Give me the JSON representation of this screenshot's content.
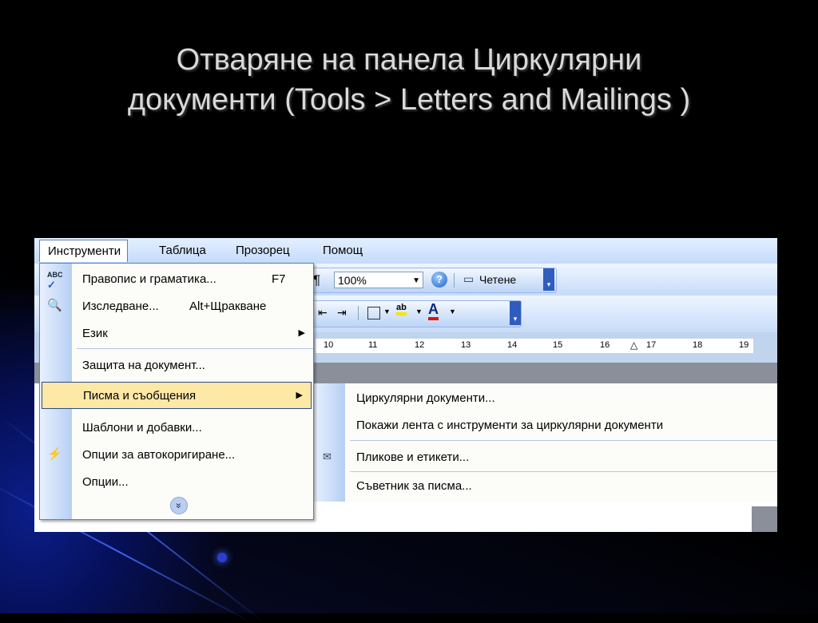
{
  "slide": {
    "title_line1": "Отваряне на панела Циркулярни",
    "title_line2": "документи (Tools > Letters and Mailings )"
  },
  "menubar": {
    "items": [
      {
        "label": "Инструменти",
        "open": true
      },
      {
        "label": "Таблица"
      },
      {
        "label": "Прозорец"
      },
      {
        "label": "Помощ"
      }
    ]
  },
  "toolbar": {
    "zoom_value": "100%",
    "read_label": "Четене"
  },
  "ruler": {
    "numbers": [
      "10",
      "11",
      "12",
      "13",
      "14",
      "15",
      "16",
      "17",
      "18",
      "19"
    ]
  },
  "tools_menu": {
    "items": [
      {
        "label": "Правопис и граматика...",
        "shortcut": "F7",
        "icon": "spelling-check-icon"
      },
      {
        "label": "Изследване...",
        "shortcut": "Alt+Щракване",
        "icon": "research-icon"
      },
      {
        "label": "Език",
        "submenu": true
      },
      {
        "label": "Защита на документ..."
      },
      {
        "label": "Писма и съобщения",
        "submenu": true,
        "highlighted": true
      },
      {
        "label": "Шаблони и добавки..."
      },
      {
        "label": "Опции за автокоригиране...",
        "icon": "autocorrect-icon"
      },
      {
        "label": "Опции..."
      }
    ],
    "expand_icon": "chevron-double-down-icon"
  },
  "letters_submenu": {
    "items": [
      {
        "label": "Циркулярни документи..."
      },
      {
        "label": "Покажи лента с инструменти за циркулярни документи"
      },
      {
        "label": "Пликове и етикети...",
        "icon": "envelope-icon"
      },
      {
        "label": "Съветник за писма..."
      }
    ]
  },
  "colors": {
    "menu_highlight": "#fde8a6",
    "menu_border": "#2b4d8a",
    "slide_title": "#d9d9d9"
  }
}
